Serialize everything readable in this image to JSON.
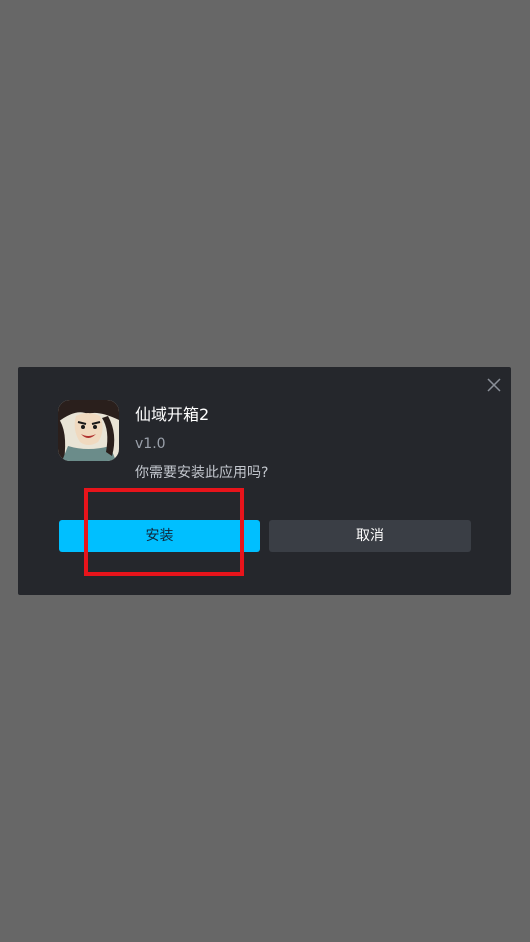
{
  "dialog": {
    "app_name": "仙域开箱2",
    "version": "v1.0",
    "prompt": "你需要安装此应用吗?",
    "install_label": "安装",
    "cancel_label": "取消",
    "close_icon": "close-icon",
    "app_icon": "app-icon"
  },
  "colors": {
    "overlay": "#676767",
    "dialog_bg": "#25272c",
    "install_bg": "#00bfff",
    "cancel_bg": "#3a3e45",
    "highlight": "#e8141b"
  }
}
